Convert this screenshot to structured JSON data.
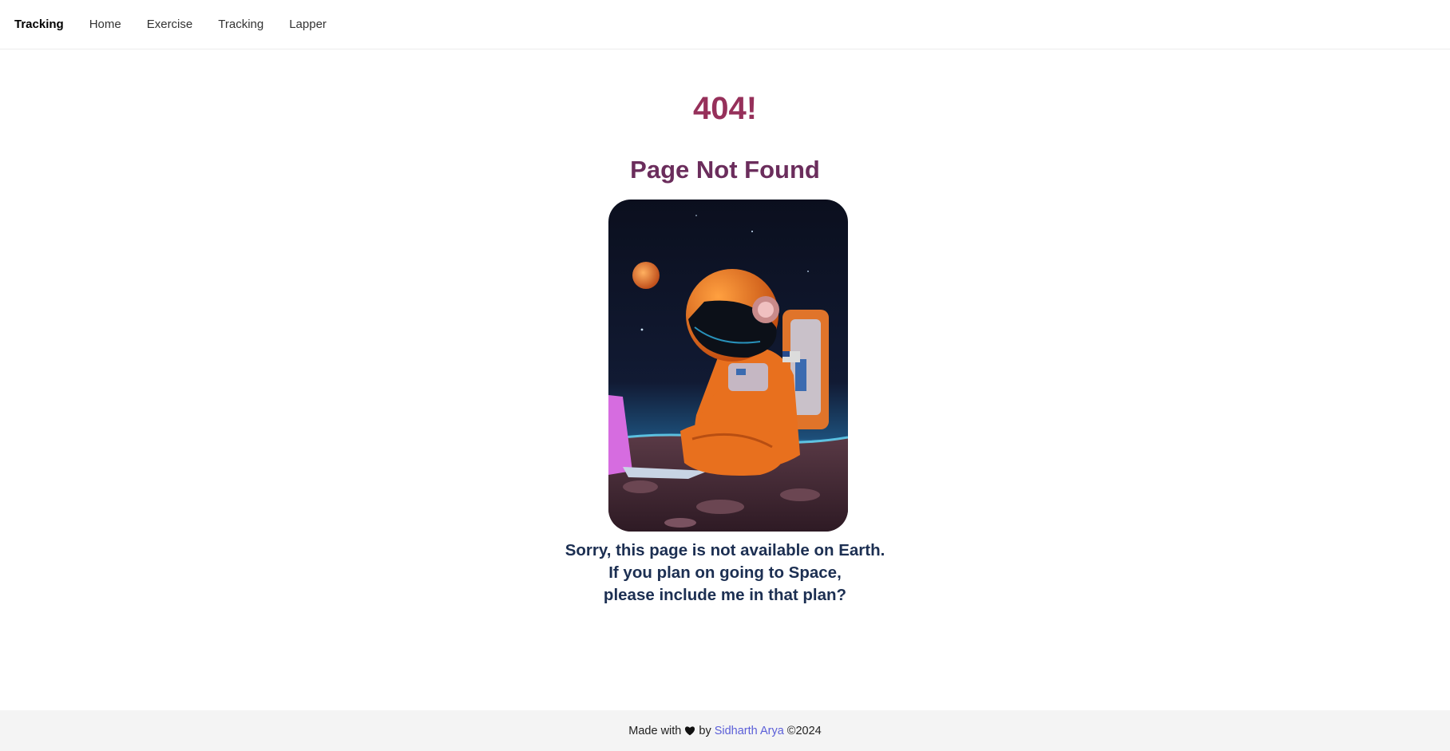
{
  "navbar": {
    "brand": "Tracking",
    "links": [
      "Home",
      "Exercise",
      "Tracking",
      "Lapper"
    ]
  },
  "error": {
    "code": "404!",
    "title": "Page Not Found",
    "message_lines": [
      "Sorry, this page is not available on Earth.",
      "If you plan on going to Space,",
      "please include me in that plan?"
    ]
  },
  "footer": {
    "made_with": "Made with",
    "heart_icon": "heart-icon",
    "by": "by",
    "author": "Sidharth Arya",
    "copyright": "©2024"
  },
  "colors": {
    "code": "#96305a",
    "title": "#6b2d5c",
    "message": "#1c2f52",
    "author_link": "#5b5fd8"
  }
}
